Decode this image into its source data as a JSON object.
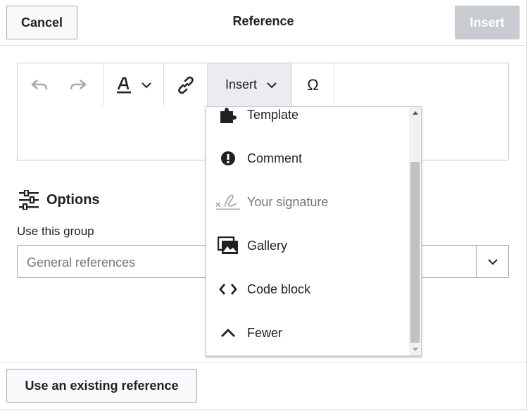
{
  "header": {
    "cancel_label": "Cancel",
    "title": "Reference",
    "insert_label": "Insert"
  },
  "toolbar": {
    "insert_label": "Insert"
  },
  "options": {
    "title": "Options",
    "group_label": "Use this group",
    "group_value": "General references"
  },
  "footer": {
    "existing_label": "Use an existing reference"
  },
  "menu": {
    "items": [
      {
        "label": "Template",
        "icon": "puzzle-icon"
      },
      {
        "label": "Comment",
        "icon": "exclamation-circle-icon"
      },
      {
        "label": "Your signature",
        "icon": "signature-icon",
        "disabled": true
      },
      {
        "label": "Gallery",
        "icon": "gallery-icon"
      },
      {
        "label": "Code block",
        "icon": "code-icon"
      },
      {
        "label": "Fewer",
        "icon": "chevron-up-icon"
      }
    ]
  },
  "colors": {
    "primary_disabled": "#c8ccd1",
    "border": "#a2a9b1",
    "text": "#202122",
    "muted": "#72777d"
  }
}
